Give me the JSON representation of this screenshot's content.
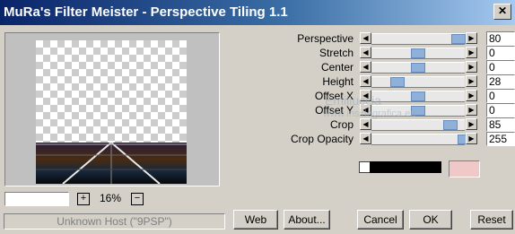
{
  "window": {
    "title": "MuRa's Filter Meister - Perspective Tiling 1.1",
    "close_glyph": "✕"
  },
  "preview": {
    "zoom": "16%",
    "zoom_in": "+",
    "zoom_out": "−"
  },
  "status": {
    "text": "Unknown Host (\"9PSP\")"
  },
  "params": [
    {
      "label": "Perspective",
      "value": "80",
      "fraction": 0.93
    },
    {
      "label": "Stretch",
      "value": "0",
      "fraction": 0.5
    },
    {
      "label": "Center",
      "value": "0",
      "fraction": 0.5
    },
    {
      "label": "Height",
      "value": "28",
      "fraction": 0.28
    },
    {
      "label": "Offset X",
      "value": "0",
      "fraction": 0.5
    },
    {
      "label": "Offset Y",
      "value": "0",
      "fraction": 0.5
    },
    {
      "label": "Crop",
      "value": "85",
      "fraction": 0.85
    },
    {
      "label": "Crop Opacity",
      "value": "255",
      "fraction": 1.0
    }
  ],
  "watermark": {
    "line1": "Emiliuccia",
    "line2": "www.insidegrafica.eu"
  },
  "color": {
    "swatch": "#f0c8c8"
  },
  "buttons": {
    "web": "Web",
    "about": "About...",
    "cancel": "Cancel",
    "ok": "OK",
    "reset": "Reset"
  },
  "arrows": {
    "left": "◀",
    "right": "▶"
  }
}
